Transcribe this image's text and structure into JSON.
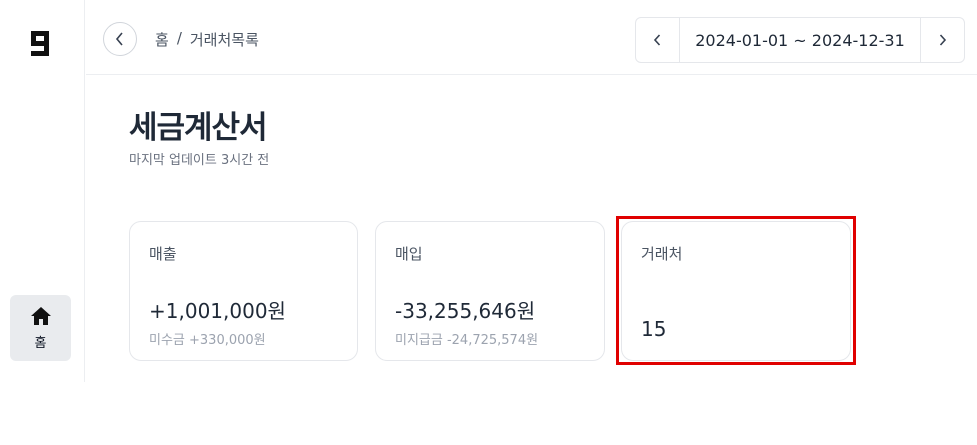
{
  "sidebar": {
    "logo_icon": "g-logo-icon",
    "home_label": "홈"
  },
  "header": {
    "breadcrumb": [
      "홈",
      "/",
      "거래처목록"
    ],
    "date_range": "2024-01-01 ~ 2024-12-31"
  },
  "page": {
    "title": "세금계산서",
    "subtitle": "마지막 업데이트 3시간 전"
  },
  "cards": [
    {
      "label": "매출",
      "value": "+1,001,000원",
      "sub": "미수금 +330,000원"
    },
    {
      "label": "매입",
      "value": "-33,255,646원",
      "sub": "미지급금 -24,725,574원"
    },
    {
      "label": "거래처",
      "value": "15"
    }
  ],
  "colors": {
    "highlight": "#e00000",
    "border": "#e5e7eb",
    "text": "#1f2937",
    "muted": "#9ca3af"
  }
}
